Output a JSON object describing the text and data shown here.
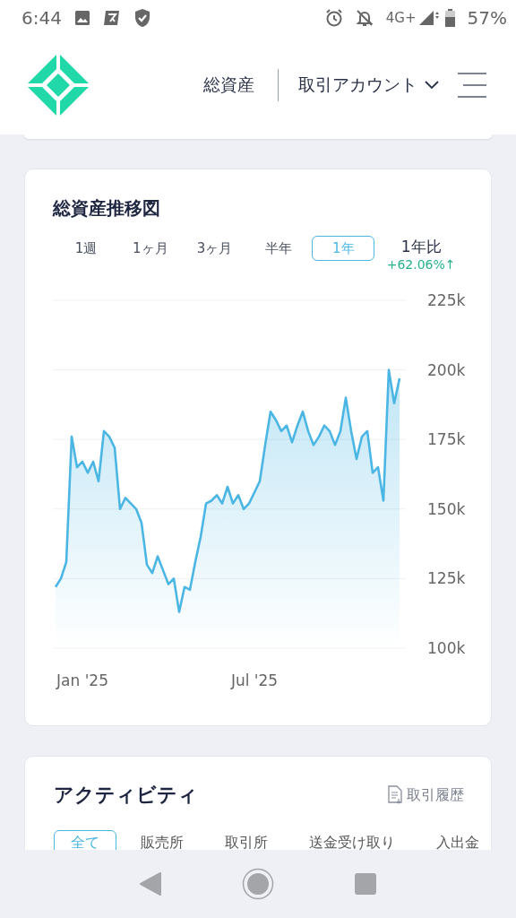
{
  "status_bar": {
    "time": "6:44",
    "network": "4G+",
    "battery": "57%"
  },
  "header": {
    "total_assets_link": "総資産",
    "account_menu": "取引アカウント"
  },
  "asset_chart": {
    "title": "総資産推移図",
    "ranges": [
      {
        "label": "1週",
        "selected": false
      },
      {
        "label": "1ヶ月",
        "selected": false
      },
      {
        "label": "3ヶ月",
        "selected": false
      },
      {
        "label": "半年",
        "selected": false
      },
      {
        "label": "1年",
        "selected": true
      }
    ],
    "comparison": {
      "label": "1年比",
      "change": "+62.06%↑"
    },
    "chart_data": {
      "type": "area",
      "grid": true,
      "categories": [
        null,
        null,
        null,
        null,
        null,
        "Jan '25",
        null,
        null,
        null,
        null,
        null,
        null,
        null,
        null,
        null,
        null,
        null,
        null,
        null,
        null,
        null,
        null,
        null,
        null,
        null,
        null,
        null,
        null,
        null,
        null,
        null,
        null,
        null,
        null,
        null,
        null,
        null,
        "Jul '25",
        null,
        null,
        null,
        null,
        null,
        null,
        null,
        null,
        null,
        null,
        null,
        null,
        null,
        null,
        null,
        null,
        null,
        null,
        null,
        null,
        null,
        null,
        null,
        null,
        null,
        null,
        null
      ],
      "ylim": [
        100,
        225
      ],
      "yticks": [
        {
          "value": 225,
          "label": "225k"
        },
        {
          "value": 200,
          "label": "200k"
        },
        {
          "value": 175,
          "label": "175k"
        },
        {
          "value": 150,
          "label": "150k"
        },
        {
          "value": 125,
          "label": "125k"
        },
        {
          "value": 100,
          "label": "100k"
        }
      ],
      "series": [
        {
          "color": "#4bb6e4",
          "values": [
            122,
            125,
            131,
            176,
            165,
            167,
            163,
            167,
            160,
            178,
            176,
            172,
            150,
            154,
            152,
            150,
            145,
            130,
            127,
            133,
            128,
            123,
            125,
            113,
            122,
            121,
            131,
            140,
            152,
            153,
            155,
            152,
            158,
            152,
            155,
            150,
            152,
            156,
            160,
            173,
            185,
            182,
            178,
            180,
            174,
            180,
            185,
            178,
            173,
            176,
            180,
            178,
            173,
            178,
            190,
            178,
            168,
            176,
            178,
            163,
            165,
            153,
            200,
            188,
            197
          ]
        }
      ]
    }
  },
  "activity": {
    "title": "アクティビティ",
    "history_link": "取引履歴",
    "tabs": [
      {
        "label": "全て",
        "selected": true
      },
      {
        "label": "販売所",
        "selected": false
      },
      {
        "label": "取引所",
        "selected": false
      },
      {
        "label": "送金受け取り",
        "selected": false
      },
      {
        "label": "入出金",
        "selected": false
      }
    ]
  }
}
